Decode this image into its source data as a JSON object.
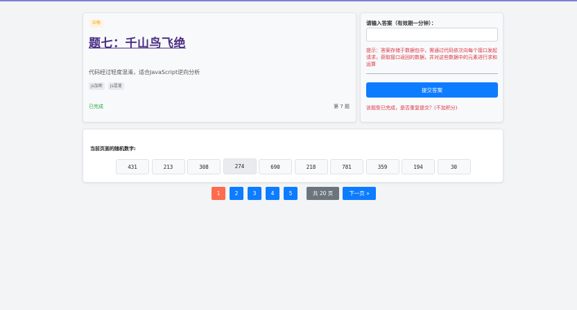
{
  "challenge": {
    "difficulty": "中等",
    "title": "题七：千山鸟飞绝",
    "description": "代码经过轻度混淆，适合JavaScript逆向分析",
    "tags": [
      "js加密",
      "js混淆"
    ],
    "status": "已完成",
    "number": "第 7 题"
  },
  "answer": {
    "label": "请输入答案（有效期一分钟）：",
    "input_value": "",
    "hint": "提示：答案存储于数据包中，需通过代码依次向每个接口发起请求，获取接口返回的数据，并对这些数据中的元素进行求和运算",
    "submit_label": "提交答案",
    "completed_note": "该题型已完成，是否重复提交？(不加积分)"
  },
  "numbers": {
    "label": "当前页面的随机数字:",
    "values": [
      "431",
      "213",
      "308",
      "274",
      "690",
      "218",
      "781",
      "359",
      "194",
      "30"
    ],
    "selected_index": 3
  },
  "pagination": {
    "pages": [
      "1",
      "2",
      "3",
      "4",
      "5"
    ],
    "active_page": "1",
    "total": "共 20 页",
    "next": "下一页 »"
  },
  "colors": {
    "accent": "#0d7cff",
    "active_page": "#ff6b4f",
    "title": "#4b2e83",
    "success": "#28a745",
    "danger": "#dc3545"
  }
}
